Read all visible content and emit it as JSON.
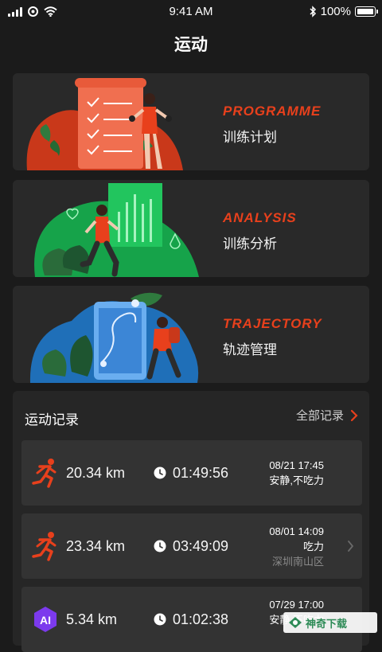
{
  "status_bar": {
    "time": "9:41 AM",
    "battery": "100%"
  },
  "page": {
    "title": "运动"
  },
  "cards": [
    {
      "en": "PROGRAMME",
      "cn": "训练计划"
    },
    {
      "en": "ANALYSIS",
      "cn": "训练分析"
    },
    {
      "en": "TRAJECTORY",
      "cn": "轨迹管理"
    }
  ],
  "records": {
    "title": "运动记录",
    "all_label": "全部记录",
    "items": [
      {
        "icon": "running-icon",
        "distance": "20.34 km",
        "duration": "01:49:56",
        "datetime": "08/21 17:45",
        "note": "安静,不吃力",
        "location": ""
      },
      {
        "icon": "running-icon",
        "distance": "23.34 km",
        "duration": "03:49:09",
        "datetime": "08/01 14:09",
        "note": "吃力",
        "location": "深圳南山区"
      },
      {
        "icon": "ai-badge-icon",
        "icon_text": "AI",
        "distance": "5.34 km",
        "duration": "01:02:38",
        "datetime": "07/29 17:00",
        "note": "安静,不吃力",
        "location": ""
      }
    ]
  },
  "watermark": {
    "text": "神奇下载"
  },
  "colors": {
    "accent": "#e8401c",
    "background": "#1b1b1b",
    "card": "#292929",
    "record": "#333333"
  }
}
